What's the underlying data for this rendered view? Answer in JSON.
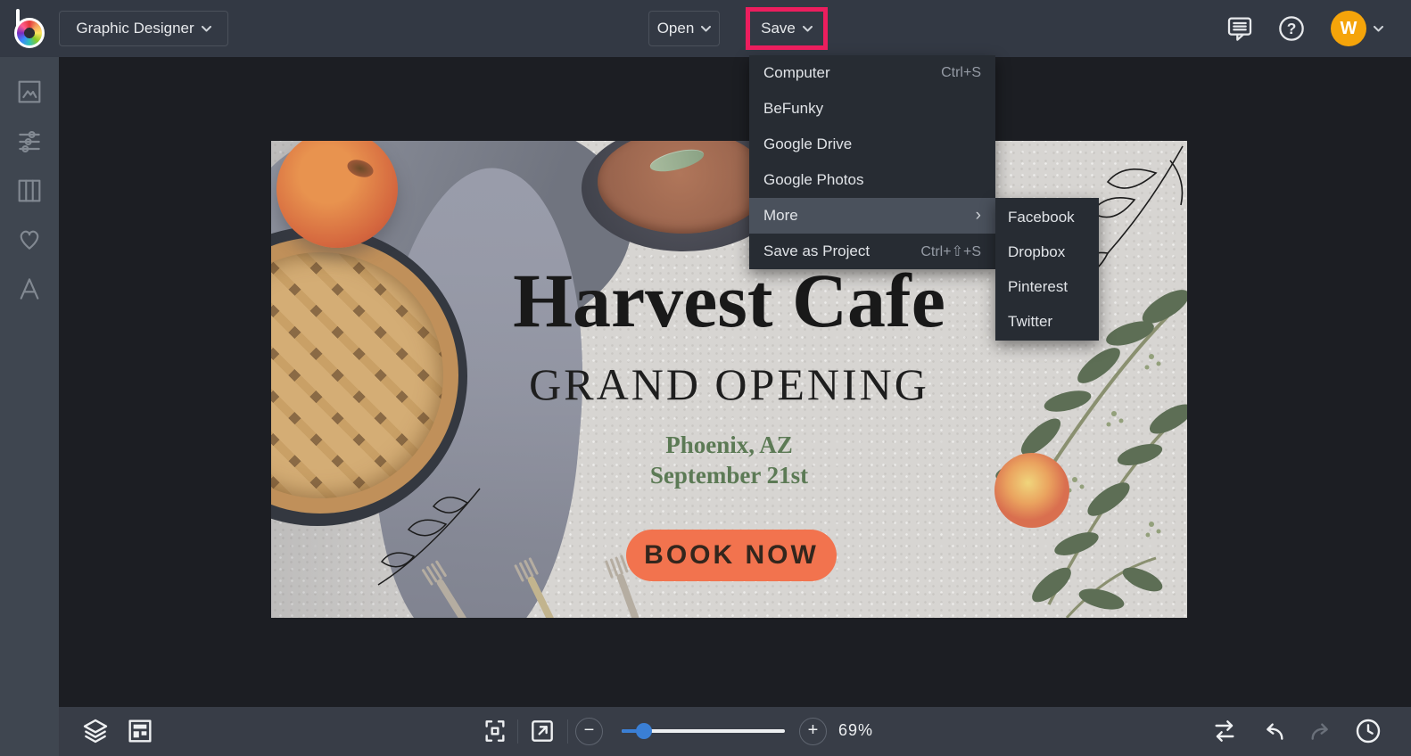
{
  "header": {
    "mode": "Graphic Designer",
    "open_label": "Open",
    "save_label": "Save"
  },
  "account": {
    "initial": "W"
  },
  "icons": {
    "help_glyph": "?",
    "topbar": [
      "befunky-logo",
      "feedback-icon",
      "help-icon",
      "avatar",
      "chevron-down-icon"
    ],
    "sidebar": [
      "image-icon",
      "adjust-sliders-icon",
      "layout-columns-icon",
      "heart-icon",
      "text-icon"
    ],
    "bottombar": [
      "layers-icon",
      "template-manager-icon",
      "fit-screen-icon",
      "export-view-icon",
      "zoom-out-icon",
      "zoom-in-icon",
      "compare-icon",
      "undo-icon",
      "redo-icon",
      "history-icon"
    ]
  },
  "save_menu": {
    "submenu_arrow": "›",
    "items": [
      {
        "label": "Computer",
        "shortcut": "Ctrl+S"
      },
      {
        "label": "BeFunky",
        "shortcut": ""
      },
      {
        "label": "Google Drive",
        "shortcut": ""
      },
      {
        "label": "Google Photos",
        "shortcut": ""
      },
      {
        "label": "More",
        "shortcut": ""
      },
      {
        "label": "Save as Project",
        "shortcut": "Ctrl+⇧+S"
      }
    ]
  },
  "share_submenu": {
    "items": [
      {
        "label": "Facebook"
      },
      {
        "label": "Dropbox"
      },
      {
        "label": "Pinterest"
      },
      {
        "label": "Twitter"
      }
    ]
  },
  "canvas": {
    "title": "Harvest Cafe",
    "subtitle": "GRAND OPENING",
    "location": "Phoenix, AZ",
    "date": "September 21st",
    "cta": "BOOK NOW"
  },
  "zoom": {
    "percent": "69%"
  },
  "colors": {
    "annotation_pink": "#ec1e5e",
    "avatar_orange": "#f5a40a",
    "slider_blue": "#3a7fd5",
    "cta_orange": "#f2734e",
    "canvas_green_text": "#5c7a55"
  }
}
